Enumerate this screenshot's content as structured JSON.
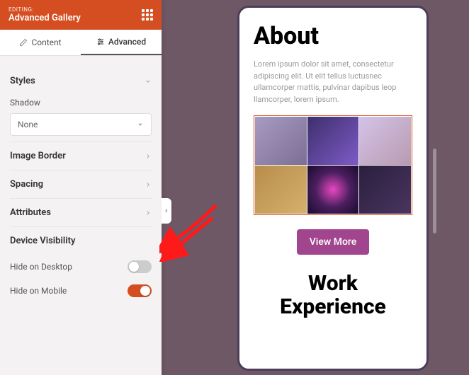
{
  "header": {
    "editing_label": "EDITING:",
    "block_name": "Advanced Gallery"
  },
  "tabs": {
    "content": "Content",
    "advanced": "Advanced"
  },
  "sections": {
    "styles": "Styles",
    "shadow_label": "Shadow",
    "shadow_value": "None",
    "image_border": "Image Border",
    "spacing": "Spacing",
    "attributes": "Attributes",
    "device_visibility": "Device Visibility",
    "hide_desktop": "Hide on Desktop",
    "hide_mobile": "Hide on Mobile"
  },
  "toggles": {
    "hide_desktop": false,
    "hide_mobile": true
  },
  "preview": {
    "about_heading": "About",
    "lorem": "Lorem ipsum dolor sit amet, consectetur adipiscing elit. Ut elit tellus luctusnec ullamcorper mattis, pulvinar dapibus leop llamcorper, lorem ipsum.",
    "view_more": "View More",
    "work_heading": "Work Experience"
  },
  "colors": {
    "accent": "#d54e21",
    "button": "#a0458e"
  }
}
